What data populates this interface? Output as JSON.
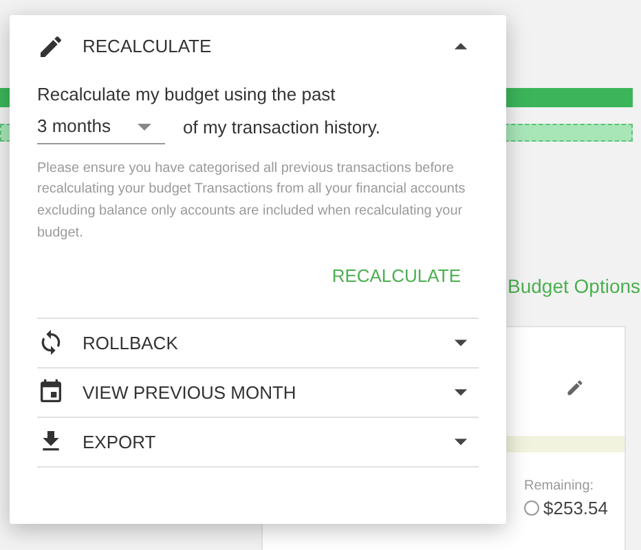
{
  "background": {
    "link": "Budget Options",
    "card": {
      "remaining_label": "Remaining:",
      "remaining_amount": "$253.54"
    }
  },
  "panel": {
    "sections": [
      {
        "kind": "recalculate",
        "title": "RECALCULATE",
        "expanded": true,
        "sentence_start": "Recalculate my budget using the past",
        "period": "3 months",
        "sentence_end": "of my transaction history.",
        "note": "Please ensure you have categorised all previous transactions before recalculating your budget Transactions from all your financial accounts excluding balance only accounts are included when recalculating your budget.",
        "action": "RECALCULATE"
      },
      {
        "kind": "rollback",
        "title": "ROLLBACK",
        "expanded": false
      },
      {
        "kind": "previous-month",
        "title": "VIEW PREVIOUS MONTH",
        "expanded": false
      },
      {
        "kind": "export",
        "title": "EXPORT",
        "expanded": false
      }
    ]
  }
}
